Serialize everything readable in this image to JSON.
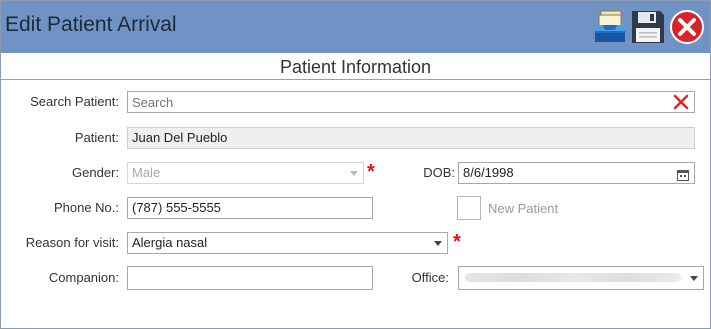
{
  "window": {
    "title": "Edit Patient Arrival"
  },
  "toolbar": {
    "archive_icon": "archive-tray-icon",
    "save_icon": "floppy-disk-icon",
    "close_icon": "close-circle-icon"
  },
  "section": {
    "title": "Patient Information"
  },
  "form": {
    "search": {
      "label": "Search Patient:",
      "placeholder": "Search",
      "value": ""
    },
    "patient": {
      "label": "Patient:",
      "value": "Juan Del Pueblo"
    },
    "gender": {
      "label": "Gender:",
      "value": "Male"
    },
    "dob": {
      "label": "DOB:",
      "value": "8/6/1998"
    },
    "phone": {
      "label": "Phone No.:",
      "value": "(787) 555-5555"
    },
    "new_patient": {
      "label": "New Patient",
      "checked": false
    },
    "reason": {
      "label": "Reason for visit:",
      "value": "Alergia nasal"
    },
    "companion": {
      "label": "Companion:",
      "value": ""
    },
    "office": {
      "label": "Office:",
      "value": ""
    },
    "required_marker": "*"
  },
  "colors": {
    "titlebar": "#6f93c5",
    "required": "#e11111",
    "clear_x": "#e0282a"
  }
}
